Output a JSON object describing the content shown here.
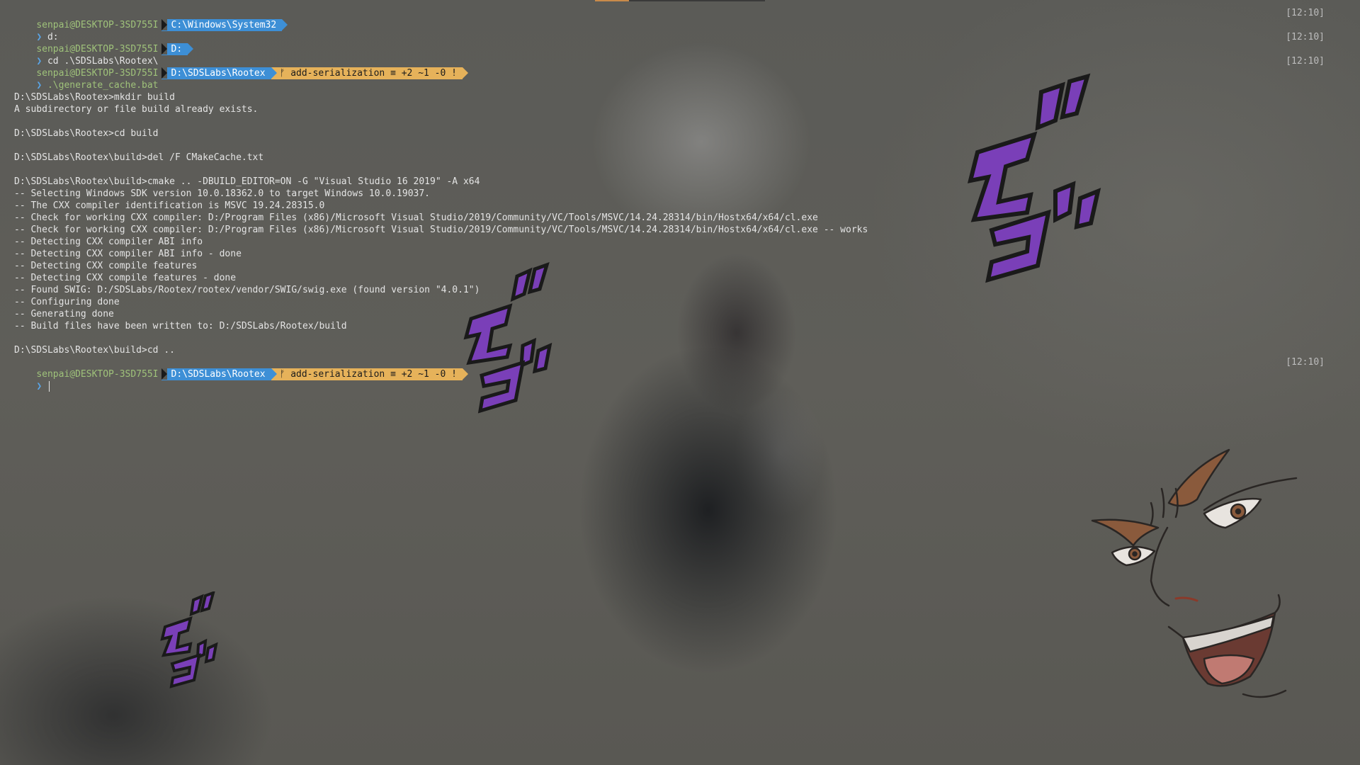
{
  "terminal": {
    "prompts": [
      {
        "user": "senpai@DESKTOP-3SD755I",
        "path": "C:\\Windows\\System32",
        "git": null,
        "time": "[12:10]",
        "command": "d:"
      },
      {
        "user": "senpai@DESKTOP-3SD755I",
        "path": "D:",
        "git": null,
        "time": "[12:10]",
        "command": "cd .\\SDSLabs\\Rootex\\"
      },
      {
        "user": "senpai@DESKTOP-3SD755I",
        "path": "D:\\SDSLabs\\Rootex",
        "git": "ᚠ add-serialization ≡ +2 ~1 -0 !",
        "time": "[12:10]",
        "command": ".\\generate_cache.bat"
      },
      {
        "user": "senpai@DESKTOP-3SD755I",
        "path": "D:\\SDSLabs\\Rootex",
        "git": "ᚠ add-serialization ≡ +2 ~1 -0 !",
        "time": "[12:10]",
        "command": ""
      }
    ],
    "prompt_symbol": "❯",
    "output": [
      "",
      "D:\\SDSLabs\\Rootex>mkdir build",
      "A subdirectory or file build already exists.",
      "",
      "D:\\SDSLabs\\Rootex>cd build",
      "",
      "D:\\SDSLabs\\Rootex\\build>del /F CMakeCache.txt",
      "",
      "D:\\SDSLabs\\Rootex\\build>cmake .. -DBUILD_EDITOR=ON -G \"Visual Studio 16 2019\" -A x64",
      "-- Selecting Windows SDK version 10.0.18362.0 to target Windows 10.0.19037.",
      "-- The CXX compiler identification is MSVC 19.24.28315.0",
      "-- Check for working CXX compiler: D:/Program Files (x86)/Microsoft Visual Studio/2019/Community/VC/Tools/MSVC/14.24.28314/bin/Hostx64/x64/cl.exe",
      "-- Check for working CXX compiler: D:/Program Files (x86)/Microsoft Visual Studio/2019/Community/VC/Tools/MSVC/14.24.28314/bin/Hostx64/x64/cl.exe -- works",
      "-- Detecting CXX compiler ABI info",
      "-- Detecting CXX compiler ABI info - done",
      "-- Detecting CXX compile features",
      "-- Detecting CXX compile features - done",
      "-- Found SWIG: D:/SDSLabs/Rootex/rootex/vendor/SWIG/swig.exe (found version \"4.0.1\")",
      "-- Configuring done",
      "-- Generating done",
      "-- Build files have been written to: D:/SDSLabs/Rootex/build",
      "",
      "D:\\SDSLabs\\Rootex\\build>cd .."
    ]
  },
  "colors": {
    "user": "#9fc27a",
    "path_segment": "#3d8fd6",
    "git_segment": "#e6b25a",
    "menacing_purple": "#7a3fb8",
    "background": "#5a5a55"
  },
  "decorations": [
    {
      "name": "menacing-go-symbols-icon"
    },
    {
      "name": "dio-face-illustration-icon"
    }
  ]
}
